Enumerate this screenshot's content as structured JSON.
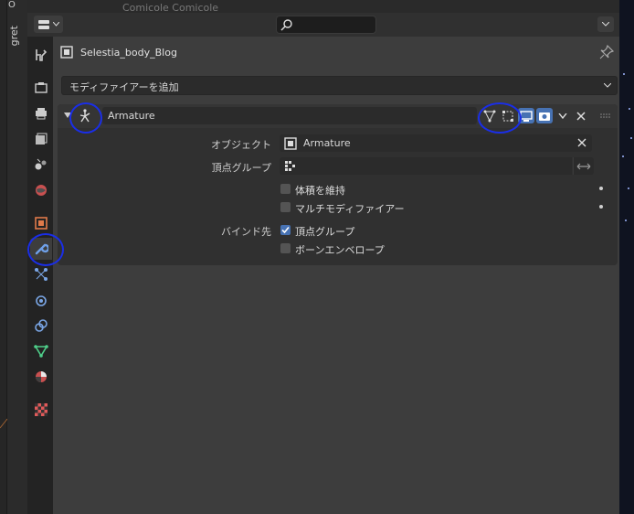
{
  "outliner": {
    "partial_text": "Comicole Comicole"
  },
  "sidebar_strip": {
    "vertical_label": "gret",
    "top_label": "O"
  },
  "header": {
    "search_placeholder": ""
  },
  "object": {
    "name": "Selestia_body_Blog"
  },
  "add_modifier": {
    "label": "モディファイアーを追加"
  },
  "modifier": {
    "name": "Armature",
    "props": {
      "object_label": "オブジェクト",
      "object_value": "Armature",
      "vertex_group_label": "頂点グループ",
      "vertex_group_value": ""
    },
    "preserve_volume": {
      "label": "体積を維持",
      "checked": false
    },
    "multi_modifier": {
      "label": "マルチモディファイアー",
      "checked": false
    },
    "bind_to_label": "バインド先",
    "bind_vertex_groups": {
      "label": "頂点グループ",
      "checked": true
    },
    "bind_bone_envelopes": {
      "label": "ボーンエンベロープ",
      "checked": false
    }
  },
  "colors": {
    "accent": "#4772b3",
    "annotation": "#1a2ee8",
    "panel": "#3d3d3d"
  }
}
